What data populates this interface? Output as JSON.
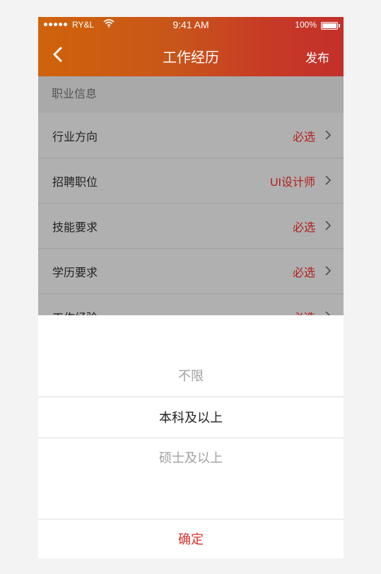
{
  "status_bar": {
    "carrier": "RY&L",
    "time": "9:41 AM",
    "battery": "100%",
    "battery_level": 1.0
  },
  "nav": {
    "title": "工作经历",
    "publish_label": "发布"
  },
  "form": {
    "section_title": "职业信息",
    "rows": [
      {
        "label": "行业方向",
        "value": "必选"
      },
      {
        "label": "招聘职位",
        "value": "UI设计师"
      },
      {
        "label": "技能要求",
        "value": "必选"
      },
      {
        "label": "学历要求",
        "value": "必选"
      },
      {
        "label": "工作经验",
        "value": "必选"
      }
    ]
  },
  "picker": {
    "options": [
      "不限",
      "本科及以上",
      "硕士及以上"
    ],
    "selected": "本科及以上",
    "confirm_label": "确定"
  },
  "colors": {
    "accent": "#d9302a",
    "header_start": "#d0630a",
    "header_end": "#c2302a",
    "value_red": "#b31e1e"
  }
}
